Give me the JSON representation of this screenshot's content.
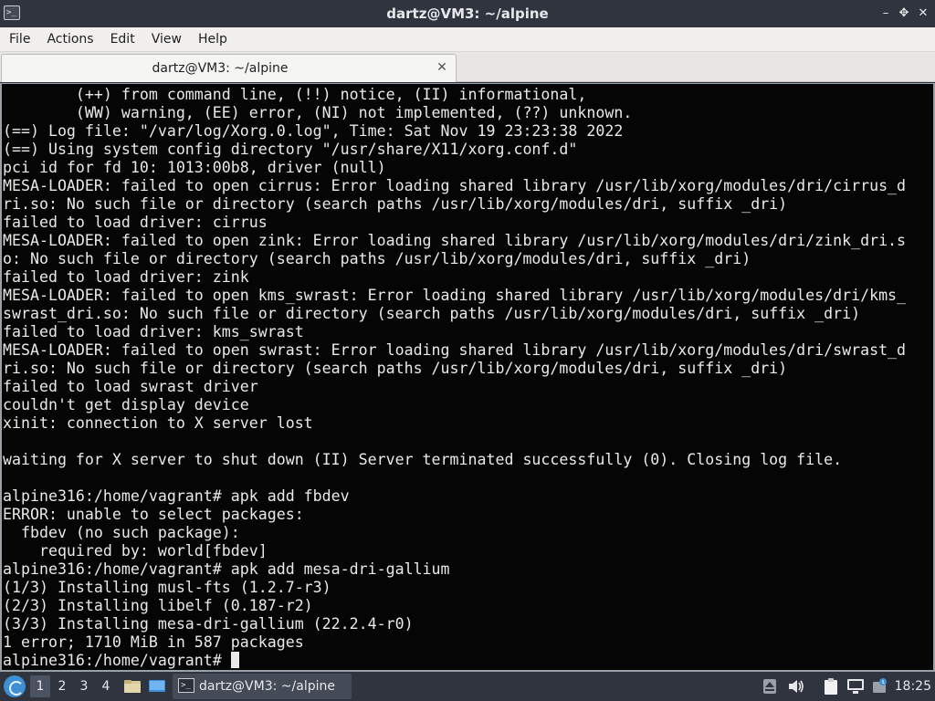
{
  "window": {
    "title": "dartz@VM3: ~/alpine",
    "minimize": "–",
    "maximize": "✥",
    "close": "✕"
  },
  "menubar": {
    "items": [
      {
        "label": "File"
      },
      {
        "label": "Actions"
      },
      {
        "label": "Edit"
      },
      {
        "label": "View"
      },
      {
        "label": "Help"
      }
    ]
  },
  "tabs": [
    {
      "label": "dartz@VM3: ~/alpine",
      "close": "✕"
    }
  ],
  "terminal": {
    "text": "        (++) from command line, (!!) notice, (II) informational,\n        (WW) warning, (EE) error, (NI) not implemented, (??) unknown.\n(==) Log file: \"/var/log/Xorg.0.log\", Time: Sat Nov 19 23:23:38 2022\n(==) Using system config directory \"/usr/share/X11/xorg.conf.d\"\npci id for fd 10: 1013:00b8, driver (null)\nMESA-LOADER: failed to open cirrus: Error loading shared library /usr/lib/xorg/modules/dri/cirrus_d\nri.so: No such file or directory (search paths /usr/lib/xorg/modules/dri, suffix _dri)\nfailed to load driver: cirrus\nMESA-LOADER: failed to open zink: Error loading shared library /usr/lib/xorg/modules/dri/zink_dri.s\no: No such file or directory (search paths /usr/lib/xorg/modules/dri, suffix _dri)\nfailed to load driver: zink\nMESA-LOADER: failed to open kms_swrast: Error loading shared library /usr/lib/xorg/modules/dri/kms_\nswrast_dri.so: No such file or directory (search paths /usr/lib/xorg/modules/dri, suffix _dri)\nfailed to load driver: kms_swrast\nMESA-LOADER: failed to open swrast: Error loading shared library /usr/lib/xorg/modules/dri/swrast_d\nri.so: No such file or directory (search paths /usr/lib/xorg/modules/dri, suffix _dri)\nfailed to load swrast driver\ncouldn't get display device\nxinit: connection to X server lost\n\nwaiting for X server to shut down (II) Server terminated successfully (0). Closing log file.\n\nalpine316:/home/vagrant# apk add fbdev\nERROR: unable to select packages:\n  fbdev (no such package):\n    required by: world[fbdev]\nalpine316:/home/vagrant# apk add mesa-dri-gallium\n(1/3) Installing musl-fts (1.2.7-r3)\n(2/3) Installing libelf (0.187-r2)\n(3/3) Installing mesa-dri-gallium (22.2.4-r0)\n1 error; 1710 MiB in 587 packages\n",
    "prompt": "alpine316:/home/vagrant# "
  },
  "taskbar": {
    "workspaces": [
      "1",
      "2",
      "3",
      "4"
    ],
    "active_workspace": "1",
    "task_label": "dartz@VM3: ~/alpine",
    "clock": "18:25"
  },
  "icons": {
    "app": "terminal-icon",
    "start": "lxqt-start-icon",
    "show_desktop": "desktop-icon",
    "file_manager": "folder-icon",
    "tray": [
      "eject-icon",
      "volume-icon",
      "clipboard-icon",
      "network-icon",
      "update-icon"
    ]
  },
  "colors": {
    "titlebar": "#2f343f",
    "terminal_bg": "#050505",
    "terminal_fg": "#e9e9e9",
    "accent": "#3e8fd3"
  }
}
